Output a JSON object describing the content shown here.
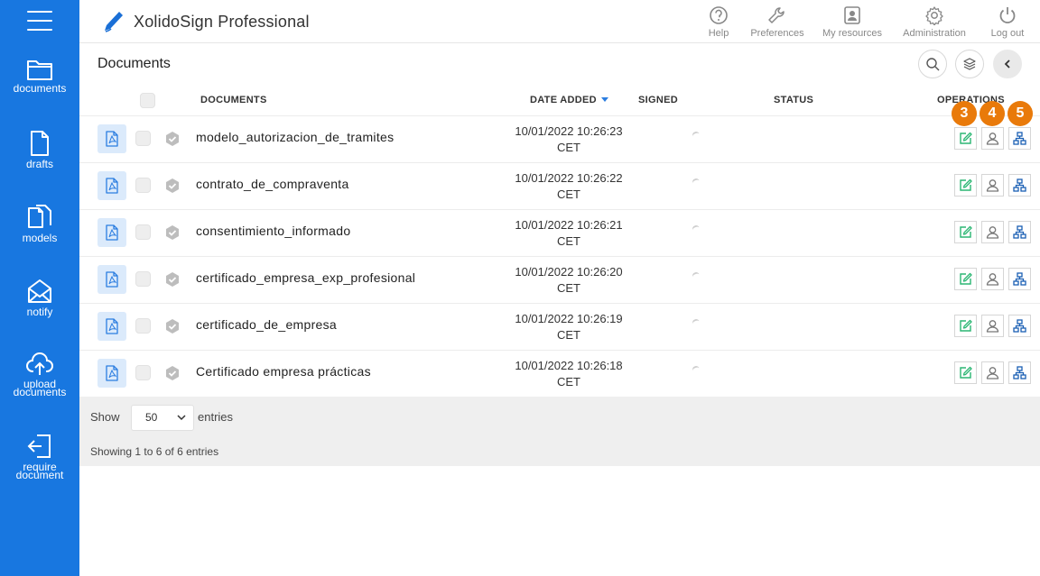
{
  "app": {
    "title": "XolidoSign Professional"
  },
  "sidebar": {
    "items": [
      {
        "label": "documents",
        "icon": "folder-icon"
      },
      {
        "label": "drafts",
        "icon": "draft-file-icon"
      },
      {
        "label": "models",
        "icon": "models-files-icon"
      },
      {
        "label": "notify",
        "icon": "mail-notify-icon"
      },
      {
        "label": "upload\ndocuments",
        "icon": "cloud-upload-icon"
      },
      {
        "label": "require\ndocument",
        "icon": "require-document-icon"
      }
    ]
  },
  "topbar": {
    "actions": [
      {
        "label": "Help",
        "icon": "help-icon"
      },
      {
        "label": "Preferences",
        "icon": "wrench-icon"
      },
      {
        "label": "My resources",
        "icon": "resources-icon"
      },
      {
        "label": "Administration",
        "icon": "gear-icon"
      },
      {
        "label": "Log out",
        "icon": "power-icon"
      }
    ]
  },
  "page": {
    "title": "Documents"
  },
  "table": {
    "headers": {
      "documents": "DOCUMENTS",
      "date_added": "DATE ADDED",
      "signed": "SIGNED",
      "status": "STATUS",
      "operations": "OPERATIONS"
    },
    "rows": [
      {
        "name": "modelo_autorizacion_de_tramites",
        "date": "10/01/2022 10:26:23",
        "tz": "CET"
      },
      {
        "name": "contrato_de_compraventa",
        "date": "10/01/2022 10:26:22",
        "tz": "CET"
      },
      {
        "name": "consentimiento_informado",
        "date": "10/01/2022 10:26:21",
        "tz": "CET"
      },
      {
        "name": "certificado_empresa_exp_profesional",
        "date": "10/01/2022 10:26:20",
        "tz": "CET"
      },
      {
        "name": "certificado_de_empresa",
        "date": "10/01/2022 10:26:19",
        "tz": "CET"
      },
      {
        "name": "Certificado empresa prácticas",
        "date": "10/01/2022 10:26:18",
        "tz": "CET"
      }
    ]
  },
  "badges": [
    "3",
    "4",
    "5"
  ],
  "footer": {
    "show_label": "Show",
    "page_size": "50",
    "entries_label": "entries",
    "showing_text": "Showing 1 to 6 of 6 entries"
  },
  "colors": {
    "sidebar": "#1877e0",
    "badge": "#e97a0a",
    "edit": "#2bb673",
    "tree": "#1a5fb4"
  }
}
